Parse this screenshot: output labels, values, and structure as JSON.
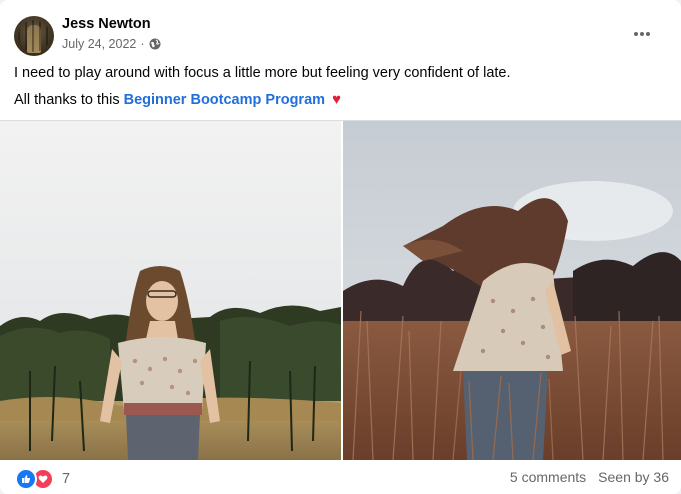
{
  "post": {
    "author": "Jess Newton",
    "date": "July 24, 2022",
    "separator": "·",
    "privacy_icon": "globe-icon",
    "more_icon": "more-options-icon",
    "text_line1": "I need to play around with focus a little more but feeling very confident of late.",
    "text_line2_prefix": "All thanks to this",
    "link_text": "Beginner Bootcamp Program",
    "emoji": "♥"
  },
  "photos": [
    {
      "label": "photo-woman-walking-field"
    },
    {
      "label": "photo-woman-hair-flip-field"
    }
  ],
  "footer": {
    "reactions_count": "7",
    "reaction_icons": [
      "like-icon",
      "love-icon"
    ],
    "comments": "5 comments",
    "seen_by": "Seen by 36"
  },
  "colors": {
    "link": "#216fdb",
    "like": "#1877f2",
    "love": "#f33e58",
    "secondary_text": "#65676b"
  }
}
